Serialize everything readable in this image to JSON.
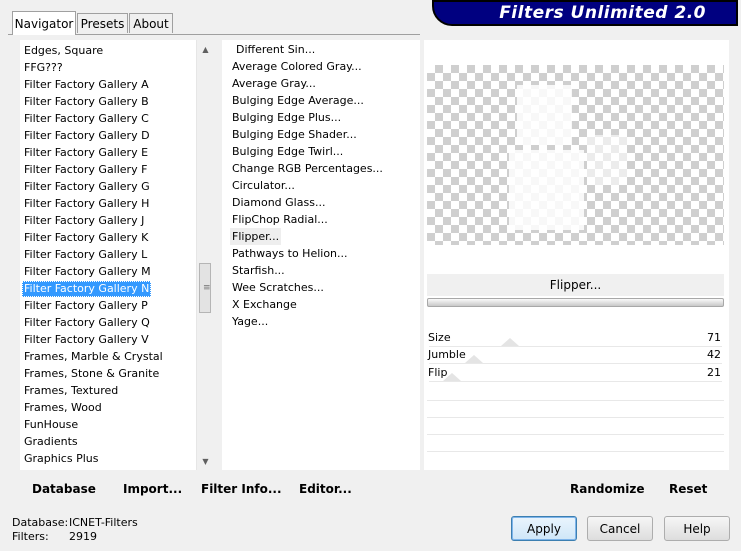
{
  "tabs": [
    {
      "label": "Navigator",
      "active": true
    },
    {
      "label": "Presets",
      "active": false
    },
    {
      "label": "About",
      "active": false
    }
  ],
  "banner_title": "Filters Unlimited 2.0",
  "categories": [
    "Edges, Square",
    "FFG???",
    "Filter Factory Gallery A",
    "Filter Factory Gallery B",
    "Filter Factory Gallery C",
    "Filter Factory Gallery D",
    "Filter Factory Gallery E",
    "Filter Factory Gallery F",
    "Filter Factory Gallery G",
    "Filter Factory Gallery H",
    "Filter Factory Gallery J",
    "Filter Factory Gallery K",
    "Filter Factory Gallery L",
    "Filter Factory Gallery M",
    "Filter Factory Gallery N",
    "Filter Factory Gallery P",
    "Filter Factory Gallery Q",
    "Filter Factory Gallery V",
    "Frames, Marble & Crystal",
    "Frames, Stone & Granite",
    "Frames, Textured",
    "Frames, Wood",
    "FunHouse",
    "Gradients",
    "Graphics Plus"
  ],
  "selected_category": "Filter Factory Gallery N",
  "filters": [
    "Different Sin...",
    "Average Colored Gray...",
    "Average Gray...",
    "Bulging Edge Average...",
    "Bulging Edge Plus...",
    "Bulging Edge Shader...",
    "Bulging Edge Twirl...",
    "Change RGB Percentages...",
    "Circulator...",
    "Diamond Glass...",
    "FlipChop Radial...",
    "Flipper...",
    "Pathways to Helion...",
    "Starfish...",
    "Wee Scratches...",
    "X Exchange",
    "Yage..."
  ],
  "selected_filter": "Flipper...",
  "current_filter_name": "Flipper...",
  "sliders": [
    {
      "label": "Size",
      "value": 71
    },
    {
      "label": "Jumble",
      "value": 42
    },
    {
      "label": "Flip",
      "value": 21
    }
  ],
  "left_toolbar": {
    "database": "Database",
    "import": "Import...",
    "filter_info": "Filter Info...",
    "editor": "Editor..."
  },
  "right_toolbar": {
    "randomize": "Randomize",
    "reset": "Reset"
  },
  "status": {
    "database_label": "Database:",
    "database_value": "ICNET-Filters",
    "filters_label": "Filters:",
    "filters_value": "2919"
  },
  "buttons": {
    "apply": "Apply",
    "cancel": "Cancel",
    "help": "Help"
  },
  "colors": {
    "banner_bg": "#000080",
    "selection_bg": "#3399ff"
  }
}
